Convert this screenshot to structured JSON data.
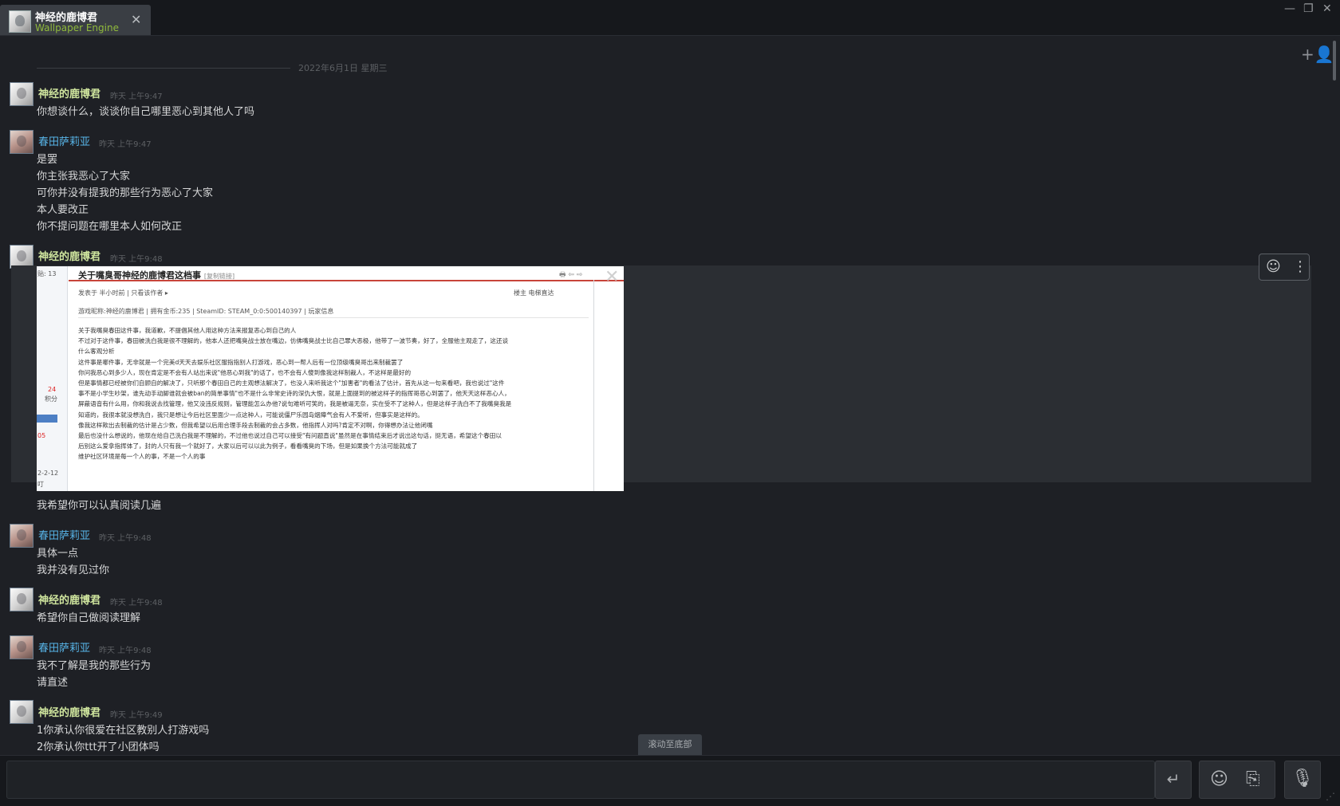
{
  "window": {
    "tab_title": "神经的鹿博君",
    "tab_subtitle": "Wallpaper Engine",
    "tab_close": "✕",
    "minimize": "—",
    "restore": "❐",
    "close": "✕"
  },
  "chat": {
    "date_separator": "2022年6月1日 星期三",
    "messages": [
      {
        "sender": "神经的鹿博君",
        "time": "昨天 上午9:47",
        "lines": [
          "你想谈什么，谈谈你自己哪里恶心到其他人了吗"
        ]
      },
      {
        "sender": "春田萨莉亚",
        "time": "昨天 上午9:47",
        "lines": [
          "是罢",
          "你主张我恶心了大家",
          "可你并没有提我的那些行为恶心了大家",
          "本人要改正",
          "你不提问题在哪里本人如何改正"
        ]
      },
      {
        "sender": "神经的鹿博君",
        "time": "昨天 上午9:48",
        "lines": [
          "我希望你可以认真阅读几遍"
        ]
      },
      {
        "sender": "春田萨莉亚",
        "time": "昨天 上午9:48",
        "lines": [
          "具体一点",
          "我并没有见过你"
        ]
      },
      {
        "sender": "神经的鹿博君",
        "time": "昨天 上午9:48",
        "lines": [
          "希望你自己做阅读理解"
        ]
      },
      {
        "sender": "春田萨莉亚",
        "time": "昨天 上午9:48",
        "lines": [
          "我不了解是我的那些行为",
          "请直述"
        ]
      },
      {
        "sender": "神经的鹿博君",
        "time": "昨天 上午9:49",
        "lines": [
          "1你承认你很爱在社区教别人打游戏吗",
          "2你承认你ttt开了小团体吗"
        ]
      }
    ]
  },
  "embed": {
    "close": "✕",
    "react_icon": "☺",
    "more_icon": "⋮",
    "screenshot": {
      "left_labels": [
        "贴: 13",
        "24",
        "积分",
        "05",
        "2-2-12",
        "叮"
      ],
      "title": "关于嘴臭哥神经的鹿博君这档事",
      "title_tag": "[复制链接]",
      "meta": "发表于 半小时前  |  只看该作者 ▸",
      "meta_right": "楼主   电梯直达",
      "info": "游戏昵称:神经的鹿博君 | 拥有金币:235 | SteamID: STEAM_0:0:500140397 | 玩家信息",
      "body": [
        "关于我嘴臭春田这件事，我道歉，不提倡其他人用这种方法来报复恶心到自己的人",
        "不过对于这件事，春田被洗白我是很不理解的，他本人还把嘴臭战士放在嘴边，仿佛嘴臭战士比自己罪大恶极，他带了一波节奏，好了，全服他主观走了，这还谈",
        "什么客观分析",
        "  这件事是哪件事，无非就是一个完美d天天去娱乐社区服指指别人打游戏，恶心到一帮人后有一位顶级嘴臭哥出来制裁罢了",
        "  你问我恶心到多少人，现在肯定是不会有人站出来说\"他恶心到我\"的话了，也不会有人傻到像我这样制裁人，不这样是最好的",
        "  但是事情都已经被你们自顾自的解决了，只听那个春田自己的主观想法解决了，也没人来听我这个\"加害者\"的看法了估计，首先从这一句来看吧，我也说过\"这件",
        "事不是小学生吵架，谁先动手动脚谁就会被ban的简单事情\"也不是什么非常史诗的深仇大恨，就是上面提到的被这样子的指挥哥恶心到罢了，他天天这样恶心人，",
        "屏蔽语音有什么用，你和我说去找管理，他又没违反规则，管理能怎么办他?说句难听可笑的，我是被逼无奈，实在受不了这种人，但是这样子洗白不了我嘴臭我是",
        "知道的，我很本就没想洗白，我只是想让今后社区里面少一点这种人，可能说僵尸乐园岛烟瘴气会有人不爱听，但事实是这样的。",
        "  像我这样欺出去制裁的估计是占少数，但我希望以后用合理手段去制裁的会占多数，他指挥人对吗?肯定不对啊，你得想办法让他闭嘴",
        "  最后也没什么想说的，他现在给自己洗白我是不理解的，不过他也说过自己可以接受\"有问题直说\"虽然是在事情结束后才说出这句话，挺无语，希望这个春田以",
        "后别这么爱拿指挥体了，封的人只有我一个就好了，大家以后可以以此为例子，看看嘴臭的下场，但是如果换个方法可能就成了",
        "  维护社区环境是每一个人的事，不是一个人的事"
      ]
    }
  },
  "bottom": {
    "scroll_to_bottom": "滚动至底部",
    "send_icon": "↵",
    "emoji_icon": "☺",
    "attach_icon": "⎘",
    "mic_icon": "🎙",
    "add_friend_icon": "+👤"
  }
}
